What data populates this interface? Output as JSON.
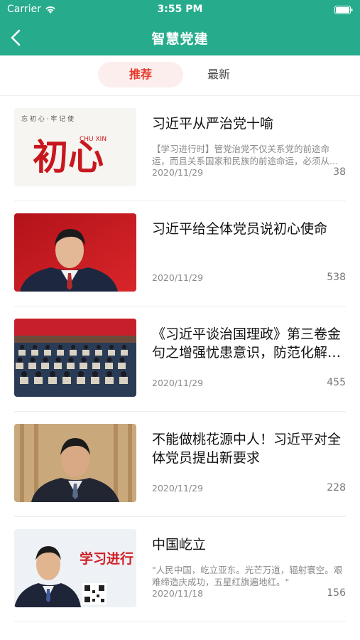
{
  "status_bar": {
    "carrier": "Carrier",
    "time": "3:55 PM",
    "wifi_icon": "wifi-icon",
    "battery_icon": "battery-icon"
  },
  "nav": {
    "title": "智慧党建",
    "back_icon": "back-arrow-icon"
  },
  "tabs": [
    {
      "label": "推荐",
      "active": true
    },
    {
      "label": "最新",
      "active": false
    }
  ],
  "articles": [
    {
      "title": "习近平从严治党十喻",
      "summary": "【学习进行时】管党治党不仅关系党的前途命运，而且关系国家和民族的前途命运，必须从严从紧。",
      "date": "2020/11/29",
      "count": "38",
      "thumb_text": {
        "top": "忘 初 心 · 牢 记 使",
        "main": "初心",
        "pinyin": "CHU XIN"
      }
    },
    {
      "title": "习近平给全体党员说初心使命",
      "summary": "",
      "date": "2020/11/29",
      "count": "538"
    },
    {
      "title": "《习近平谈治国理政》第三卷金句之增强忧患意识，防范化解重大风险",
      "summary": "",
      "date": "2020/11/29",
      "count": "455"
    },
    {
      "title": "不能做桃花源中人！习近平对全体党员提出新要求",
      "summary": "",
      "date": "2020/11/29",
      "count": "228"
    },
    {
      "title": "中国屹立",
      "summary": "\"人民中国，屹立亚东。光芒万道，辐射寰空。艰难缔造庆成功，五星红旗遍地红。\"",
      "date": "2020/11/18",
      "count": "156",
      "thumb_text": {
        "brand": "学习进行"
      }
    }
  ],
  "colors": {
    "header": "#26ac8c",
    "active_tab_text": "#e83a2a",
    "active_tab_bg": "#fbeeed"
  }
}
